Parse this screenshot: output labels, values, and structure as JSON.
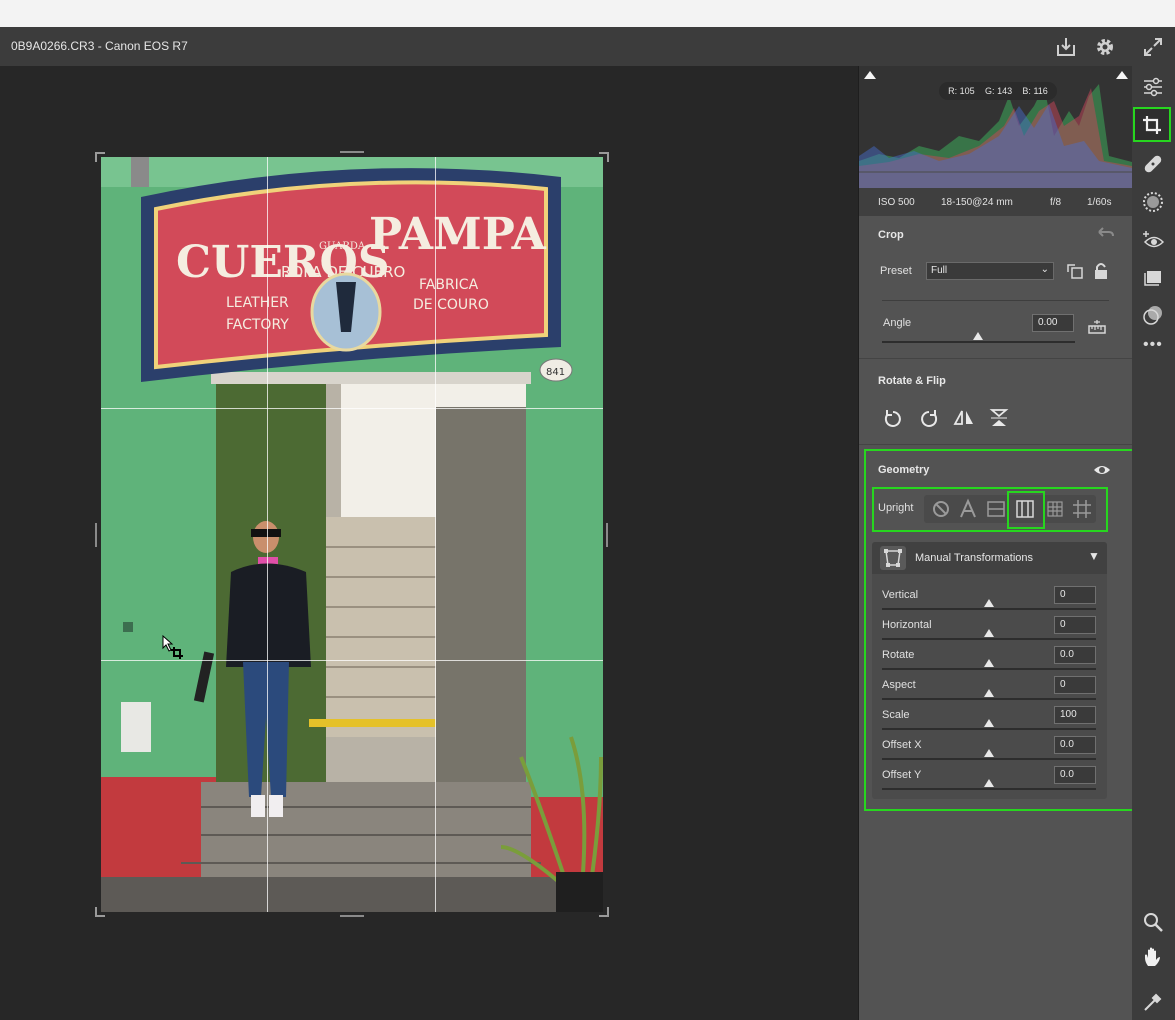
{
  "window": {
    "title": "0B9A0266.CR3  -  Canon EOS R7"
  },
  "photo": {
    "sign_line1": "CUEROS",
    "sign_small": "GUARDA",
    "sign_line2": "PAMPA",
    "sign_line3": "ROPA DE CUERO",
    "sign_left": [
      "LEATHER",
      "FACTORY"
    ],
    "sign_right": [
      "FABRICA",
      "DE COURO"
    ],
    "house_number": "841"
  },
  "histogram": {
    "r_label": "R:",
    "r": "105",
    "g_label": "G:",
    "g": "143",
    "b_label": "B:",
    "b": "116"
  },
  "exif": {
    "iso": "ISO 500",
    "lens": "18-150@24 mm",
    "aperture": "f/8",
    "shutter": "1/60s"
  },
  "crop": {
    "title": "Crop",
    "preset_label": "Preset",
    "preset_value": "Full",
    "angle_label": "Angle",
    "angle_value": "0.00"
  },
  "rotate": {
    "title": "Rotate & Flip"
  },
  "geometry": {
    "title": "Geometry",
    "upright_label": "Upright",
    "manual_title": "Manual Transformations",
    "sliders": [
      {
        "label": "Vertical",
        "value": "0"
      },
      {
        "label": "Horizontal",
        "value": "0"
      },
      {
        "label": "Rotate",
        "value": "0.0"
      },
      {
        "label": "Aspect",
        "value": "0"
      },
      {
        "label": "Scale",
        "value": "100"
      },
      {
        "label": "Offset X",
        "value": "0.0"
      },
      {
        "label": "Offset Y",
        "value": "0.0"
      }
    ]
  },
  "colors": {
    "highlight": "#27d61f",
    "panel": "#535353",
    "toolstrip": "#3c3c3c"
  },
  "icons": [
    "download-icon",
    "gear-icon",
    "fullscreen-icon",
    "sliders-icon",
    "crop-icon",
    "healing-icon",
    "masking-icon",
    "redeye-icon",
    "presets-icon",
    "versions-icon",
    "more-icon",
    "zoom-icon",
    "hand-icon",
    "eyedropper-icon"
  ]
}
